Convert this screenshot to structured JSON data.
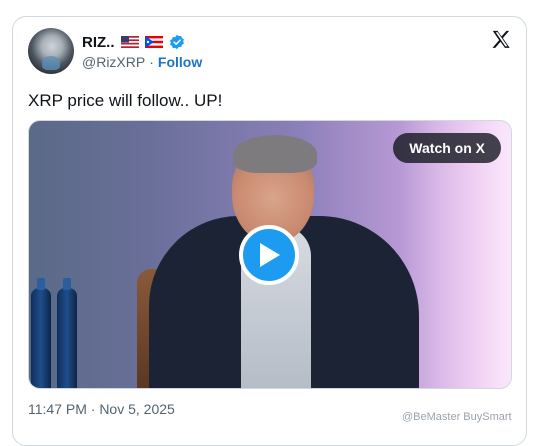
{
  "user": {
    "display_name": "RIZ..",
    "flags": [
      "us-flag",
      "puerto-rico-flag"
    ],
    "verified_icon": "verified-badge-icon",
    "handle": "@RizXRP",
    "separator": "·",
    "follow_label": "Follow"
  },
  "platform": {
    "logo_icon": "x-logo-icon"
  },
  "post": {
    "text": "XRP price will follow.. UP!"
  },
  "media": {
    "watch_label": "Watch on X",
    "play_icon": "play-icon"
  },
  "meta": {
    "timestamp": "11:47 PM · Nov 5, 2025"
  },
  "watermark": {
    "text": "@BeMaster BuySmart"
  },
  "colors": {
    "accent": "#1d9bf0",
    "follow": "#1d74c5",
    "text": "#0f1419",
    "muted": "#536471"
  }
}
